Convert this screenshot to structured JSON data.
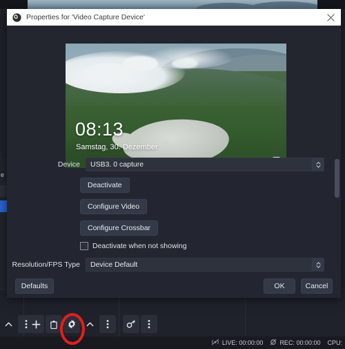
{
  "dialog": {
    "title": "Properties for 'Video Capture Device'",
    "app_icon": "obs-logo-icon",
    "close_icon": "close-icon",
    "preview": {
      "clock_time": "08:13",
      "clock_date": "Samstag, 30. Dezember",
      "ease_of_access_icon": "ease-of-access-icon"
    },
    "form": {
      "device_label": "Device",
      "device_value": "USB3. 0 capture",
      "deactivate_button": "Deactivate",
      "configure_video_button": "Configure Video",
      "configure_crossbar_button": "Configure Crossbar",
      "deactivate_when_not_showing_label": "Deactivate when not showing",
      "deactivate_when_not_showing_checked": false,
      "resolution_fps_label": "Resolution/FPS Type",
      "resolution_fps_value": "Device Default"
    },
    "footer": {
      "defaults_button": "Defaults",
      "ok_button": "OK",
      "cancel_button": "Cancel"
    }
  },
  "annotation": {
    "highlight_color": "#e81c1c",
    "target": "settings-gear-button"
  },
  "dock": {
    "sources_toolbar": [
      {
        "icon": "chevron-up-icon",
        "name": "move-source-up-button"
      },
      {
        "icon": "vertical-dots-icon",
        "name": "scene-options-button"
      }
    ],
    "sources_toolbar2": [
      {
        "icon": "plus-icon",
        "name": "add-source-button"
      },
      {
        "icon": "trash-icon",
        "name": "remove-source-button"
      },
      {
        "icon": "gear-icon",
        "name": "settings-gear-button"
      },
      {
        "icon": "chevron-up-icon",
        "name": "move-up-button"
      },
      {
        "icon": "vertical-dots-icon",
        "name": "source-options-button"
      }
    ],
    "mixer_toolbar": [
      {
        "icon": "filter-icon",
        "name": "audio-filters-button"
      },
      {
        "icon": "vertical-dots-icon",
        "name": "mixer-options-button"
      }
    ]
  },
  "statusbar": {
    "live_icon": "broadcast-muted-icon",
    "live_label": "LIVE: 00:00:00",
    "rec_icon": "record-muted-icon",
    "rec_label": "REC: 00:00:00",
    "cpu_label": "CPU:"
  },
  "colors": {
    "dialog_bg": "#232630",
    "window_bg": "#1f222b",
    "accent": "#2b62d4",
    "titlebar_bg": "#ffffff"
  }
}
